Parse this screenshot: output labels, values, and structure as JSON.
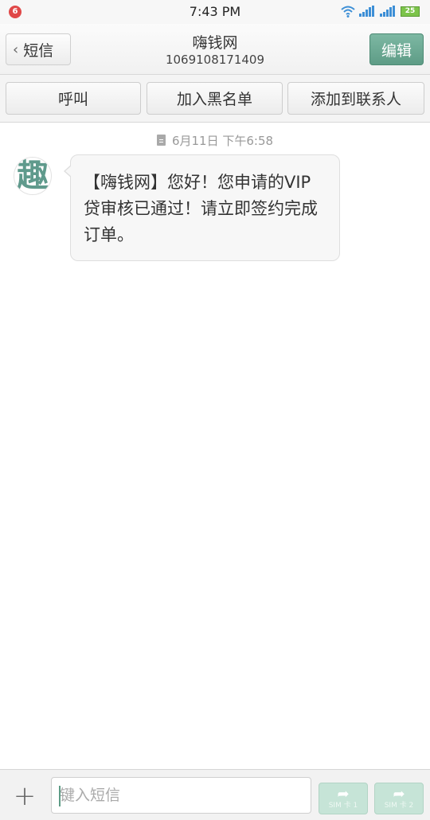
{
  "status_bar": {
    "notification_count": "6",
    "time": "7:43 PM",
    "battery": "25",
    "icons": [
      "wifi-icon",
      "signal-icon",
      "signal-icon",
      "battery-icon"
    ]
  },
  "header": {
    "back_label": "短信",
    "title": "嗨钱网",
    "number": "1069108171409",
    "edit_label": "编辑"
  },
  "actions": {
    "call_label": "呼叫",
    "block_label": "加入黑名单",
    "add_contact_label": "添加到联系人"
  },
  "conversation": {
    "timestamp": "6月11日 下午6:58",
    "avatar_text": "趣",
    "messages": [
      {
        "text": "【嗨钱网】您好！您申请的VIP贷审核已通过！请立即签约完成订单。"
      }
    ]
  },
  "composer": {
    "placeholder": "键入短信",
    "sim1_label": "SIM 卡 1",
    "sim2_label": "SIM 卡 2"
  },
  "colors": {
    "accent": "#5e9c86",
    "notification": "#e04848",
    "battery": "#7cc44a",
    "signal": "#3d8fd6"
  }
}
